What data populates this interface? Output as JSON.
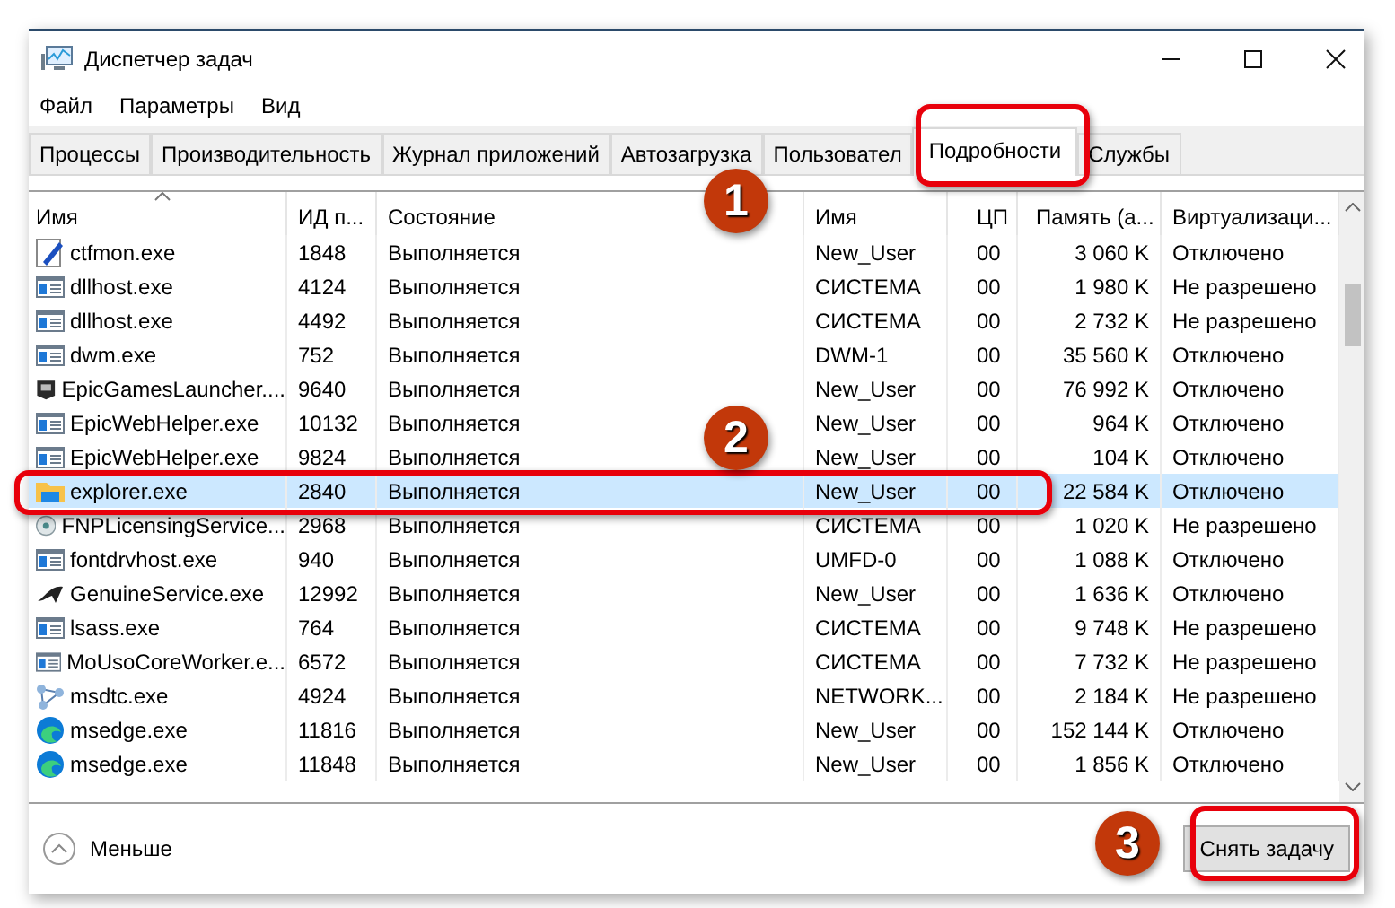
{
  "window": {
    "title": "Диспетчер задач"
  },
  "menu": [
    "Файл",
    "Параметры",
    "Вид"
  ],
  "tabs": [
    {
      "label": "Процессы",
      "selected": false
    },
    {
      "label": "Производительность",
      "selected": false
    },
    {
      "label": "Журнал приложений",
      "selected": false
    },
    {
      "label": "Автозагрузка",
      "selected": false
    },
    {
      "label": "Пользовател",
      "selected": false
    },
    {
      "label": "Подробности",
      "selected": true
    },
    {
      "label": "Службы",
      "selected": false
    }
  ],
  "table": {
    "columns": [
      "Имя",
      "ИД п...",
      "Состояние",
      "Имя",
      "ЦП",
      "Память (а...",
      "Виртуализаци..."
    ],
    "rows": [
      {
        "kind": "pen",
        "name": "ctfmon.exe",
        "pid": "1848",
        "status": "Выполняется",
        "user": "New_User",
        "cpu": "00",
        "memory": "3 060 K",
        "virtualization": "Отключено",
        "selected": false
      },
      {
        "kind": "app",
        "name": "dllhost.exe",
        "pid": "4124",
        "status": "Выполняется",
        "user": "СИСТЕМА",
        "cpu": "00",
        "memory": "1 980 K",
        "virtualization": "Не разрешено",
        "selected": false
      },
      {
        "kind": "app",
        "name": "dllhost.exe",
        "pid": "4492",
        "status": "Выполняется",
        "user": "СИСТЕМА",
        "cpu": "00",
        "memory": "2 732 K",
        "virtualization": "Не разрешено",
        "selected": false
      },
      {
        "kind": "app",
        "name": "dwm.exe",
        "pid": "752",
        "status": "Выполняется",
        "user": "DWM-1",
        "cpu": "00",
        "memory": "35 560 K",
        "virtualization": "Отключено",
        "selected": false
      },
      {
        "kind": "epic",
        "name": "EpicGamesLauncher....",
        "pid": "9640",
        "status": "Выполняется",
        "user": "New_User",
        "cpu": "00",
        "memory": "76 992 K",
        "virtualization": "Отключено",
        "selected": false
      },
      {
        "kind": "app",
        "name": "EpicWebHelper.exe",
        "pid": "10132",
        "status": "Выполняется",
        "user": "New_User",
        "cpu": "00",
        "memory": "964 K",
        "virtualization": "Отключено",
        "selected": false
      },
      {
        "kind": "app",
        "name": "EpicWebHelper.exe",
        "pid": "9824",
        "status": "Выполняется",
        "user": "New_User",
        "cpu": "00",
        "memory": "104 K",
        "virtualization": "Отключено",
        "selected": false
      },
      {
        "kind": "folder",
        "name": "explorer.exe",
        "pid": "2840",
        "status": "Выполняется",
        "user": "New_User",
        "cpu": "00",
        "memory": "22 584 K",
        "virtualization": "Отключено",
        "selected": true
      },
      {
        "kind": "disc",
        "name": "FNPLicensingService...",
        "pid": "2968",
        "status": "Выполняется",
        "user": "СИСТЕМА",
        "cpu": "00",
        "memory": "1 020 K",
        "virtualization": "Не разрешено",
        "selected": false
      },
      {
        "kind": "app",
        "name": "fontdrvhost.exe",
        "pid": "940",
        "status": "Выполняется",
        "user": "UMFD-0",
        "cpu": "00",
        "memory": "1 088 K",
        "virtualization": "Отключено",
        "selected": false
      },
      {
        "kind": "genuine",
        "name": "GenuineService.exe",
        "pid": "12992",
        "status": "Выполняется",
        "user": "New_User",
        "cpu": "00",
        "memory": "1 636 K",
        "virtualization": "Отключено",
        "selected": false
      },
      {
        "kind": "app",
        "name": "lsass.exe",
        "pid": "764",
        "status": "Выполняется",
        "user": "СИСТЕМА",
        "cpu": "00",
        "memory": "9 748 K",
        "virtualization": "Не разрешено",
        "selected": false
      },
      {
        "kind": "app",
        "name": "MoUsoCoreWorker.e...",
        "pid": "6572",
        "status": "Выполняется",
        "user": "СИСТЕМА",
        "cpu": "00",
        "memory": "7 732 K",
        "virtualization": "Не разрешено",
        "selected": false
      },
      {
        "kind": "network",
        "name": "msdtc.exe",
        "pid": "4924",
        "status": "Выполняется",
        "user": "NETWORK...",
        "cpu": "00",
        "memory": "2 184 K",
        "virtualization": "Не разрешено",
        "selected": false
      },
      {
        "kind": "edge",
        "name": "msedge.exe",
        "pid": "11816",
        "status": "Выполняется",
        "user": "New_User",
        "cpu": "00",
        "memory": "152 144 K",
        "virtualization": "Отключено",
        "selected": false
      },
      {
        "kind": "edge",
        "name": "msedge.exe",
        "pid": "11848",
        "status": "Выполняется",
        "user": "New_User",
        "cpu": "00",
        "memory": "1 856 K",
        "virtualization": "Отключено",
        "selected": false
      }
    ]
  },
  "footer": {
    "toggle": "Меньше",
    "button": "Снять задачу"
  },
  "annotations": [
    {
      "number": "1"
    },
    {
      "number": "2"
    },
    {
      "number": "3"
    }
  ]
}
